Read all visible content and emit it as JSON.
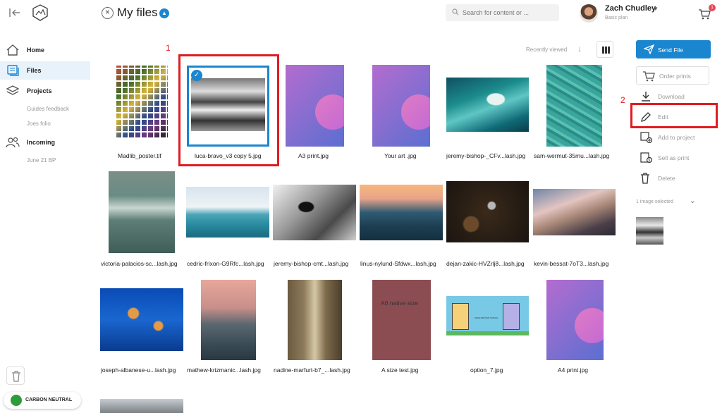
{
  "header": {
    "title": "My files",
    "search_placeholder": "Search for content or ...",
    "user_name": "Zach Chudley",
    "user_plan": "Basic plan",
    "cart_count": "1"
  },
  "sidebar": {
    "items": [
      {
        "label": "Home",
        "icon": "home-icon"
      },
      {
        "label": "Files",
        "icon": "files-icon",
        "active": true
      },
      {
        "label": "Projects",
        "icon": "layers-icon"
      },
      {
        "label": "Incoming",
        "icon": "users-icon"
      }
    ],
    "project_subitems": [
      "Guides feedback",
      "Joes folio"
    ],
    "incoming_subitems": [
      "June 21 BP"
    ],
    "carbon_label": "CARBON NEUTRAL"
  },
  "sort": {
    "label": "Recently viewed"
  },
  "annotations": {
    "first": "1",
    "second": "2"
  },
  "files": [
    {
      "name": "Madlib_poster.tif"
    },
    {
      "name": "luca-bravo_v3 copy 5.jpg",
      "selected": true
    },
    {
      "name": "A3 print.jpg"
    },
    {
      "name": "Your art .jpg"
    },
    {
      "name": "jeremy-bishop-_CFv...lash.jpg"
    },
    {
      "name": "sam-wermut-35mu...lash.jpg"
    },
    {
      "name": "victoria-palacios-sc...lash.jpg"
    },
    {
      "name": "cedric-frixon-G9Rfc...lash.jpg"
    },
    {
      "name": "jeremy-bishop-cmt...lash.jpg"
    },
    {
      "name": "linus-nylund-Sfdwx...lash.jpg"
    },
    {
      "name": "dejan-zakic-HVZrlj8...lash.jpg"
    },
    {
      "name": "kevin-bessat-7oT3...lash.jpg"
    },
    {
      "name": "joseph-albanese-u...lash.jpg"
    },
    {
      "name": "mathew-krizmanic...lash.jpg"
    },
    {
      "name": "nadine-marfurt-b7_...lash.jpg"
    },
    {
      "name": "A size test.jpg",
      "thumb_text": "A0 native size"
    },
    {
      "name": "option_7.jpg",
      "thumb_text": "MAKE BETTER THINGS"
    },
    {
      "name": "A4 print.jpg"
    }
  ],
  "actions": {
    "send": "Send File",
    "order": "Order prints",
    "download": "Download",
    "edit": "Edit",
    "add_to_project": "Add to project",
    "sell_as_print": "Sell as print",
    "delete": "Delete"
  },
  "selection": {
    "label": "1 image selected",
    "count": 1
  },
  "colors": {
    "accent": "#1a86d0",
    "highlight_red": "#e11b22",
    "active_nav_bg": "#e8f2fb"
  }
}
